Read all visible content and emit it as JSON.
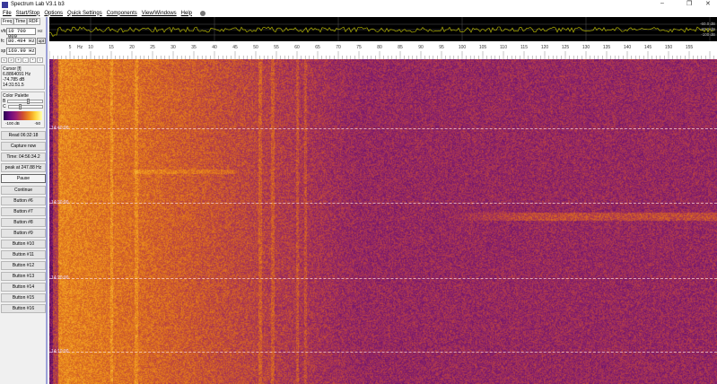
{
  "window": {
    "title": "Spectrum Lab V3.1 b3",
    "controls": [
      "–",
      "❐",
      "✕"
    ]
  },
  "menu": [
    "File",
    "Start/Stop",
    "Options",
    "Quick Settings",
    "Components",
    "View/Windows",
    "Help"
  ],
  "left": {
    "tabs": [
      "Freq",
      "Time",
      "RDF"
    ],
    "vfo": {
      "label": "vfo",
      "value": "10 700 000",
      "unit": "Hz"
    },
    "fc": {
      "label": "fc",
      "value": "80.494 Hz",
      "button": "opt"
    },
    "sp": {
      "label": "sp",
      "value": "160.99 Hz"
    },
    "small_buttons": [
      "<",
      ">",
      "+",
      "-",
      "*",
      "/"
    ],
    "cursor": {
      "title": "Cursor [f]",
      "freq": "6.8864091 Hz",
      "level": "-74.785 dB",
      "time": "14:31:51.5"
    },
    "palette": {
      "title": "Color Palette",
      "b_label": "B",
      "c_label": "C",
      "b_value": 0.55,
      "c_value": 0.3,
      "min": "-100 dB",
      "max": "-50"
    },
    "buttons": [
      {
        "label": "Read 06:32:18"
      },
      {
        "label": "Capture now"
      },
      {
        "label": "Time:  04:56:34.2"
      },
      {
        "label": "peak at 247.88 Hz"
      },
      {
        "label": "Pause",
        "pressed": true
      },
      {
        "label": "Continue"
      },
      {
        "label": "Button #6"
      },
      {
        "label": "Button #7"
      },
      {
        "label": "Button #8"
      },
      {
        "label": "Button #9"
      },
      {
        "label": "Button #10"
      },
      {
        "label": "Button #11"
      },
      {
        "label": "Button #12"
      },
      {
        "label": "Button #13"
      },
      {
        "label": "Button #14"
      },
      {
        "label": "Button #15"
      },
      {
        "label": "Button #16"
      }
    ]
  },
  "spectrum": {
    "db_labels": [
      "-60.0 dB",
      "-80.0 dB",
      "-100 dB"
    ],
    "trace_color": "#c8c800"
  },
  "freq_axis": {
    "unit": "Hz",
    "min": 0,
    "max": 162,
    "labels": [
      5,
      10,
      15,
      20,
      25,
      30,
      35,
      40,
      45,
      50,
      55,
      60,
      65,
      70,
      75,
      80,
      85,
      90,
      95,
      100,
      105,
      110,
      115,
      120,
      125,
      130,
      135,
      140,
      145,
      150,
      155
    ]
  },
  "waterfall": {
    "time_labels": [
      "14:40:00",
      "14:30:00",
      "14:20:00",
      "14:10:00"
    ]
  }
}
